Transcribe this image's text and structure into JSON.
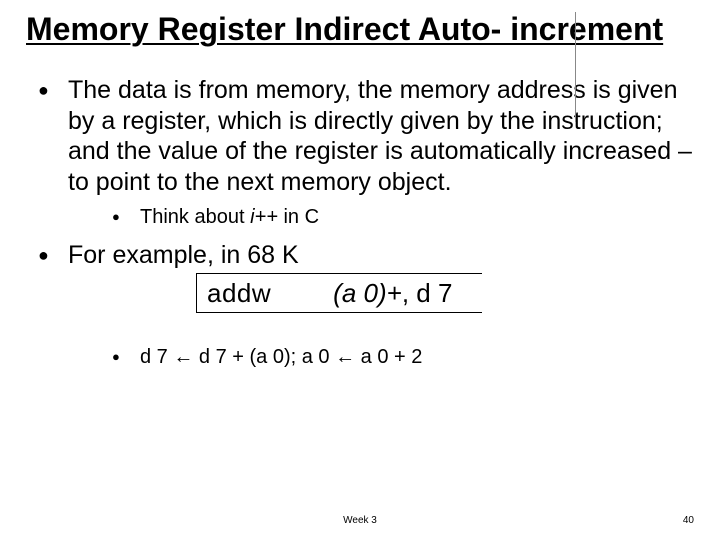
{
  "title": "Memory Register Indirect Auto- increment",
  "body": {
    "p1": "The data is from memory, the memory address is given by a register, which is directly given by the instruction; and the value of the register is automatically increased – to point to the next memory object.",
    "sub1_prefix": "Think about ",
    "sub1_code": "i++",
    "sub1_suffix": " in C",
    "p2": "For example, in 68 K",
    "code_op": "addw",
    "code_arg_italic": "(a 0)+",
    "code_arg_rest": ", d 7",
    "sub2": "d 7 ← d 7 + (a 0); a 0 ← a 0 + 2"
  },
  "footer": "Week 3",
  "page": "40"
}
